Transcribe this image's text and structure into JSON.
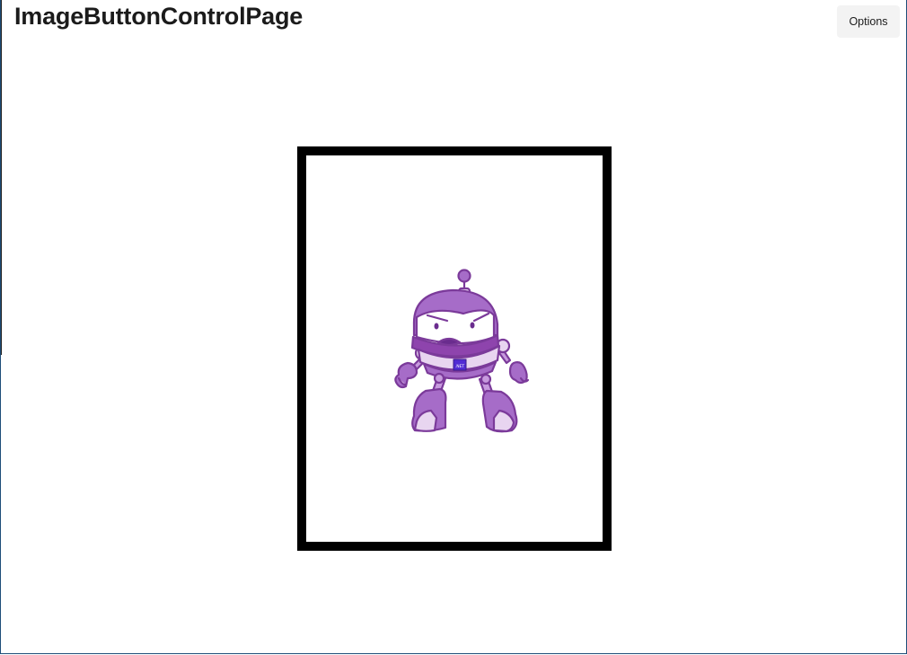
{
  "page": {
    "title": "ImageButtonControlPage"
  },
  "toolbar": {
    "options_label": "Options"
  },
  "image_button": {
    "image_icon": "dotnet-bot-icon",
    "badge_text": ".NET",
    "border_color": "#000000"
  },
  "colors": {
    "bot_purple": "#9b59b6",
    "bot_purple_dark": "#6a2c8e",
    "bot_purple_light": "#e8d5f0"
  }
}
